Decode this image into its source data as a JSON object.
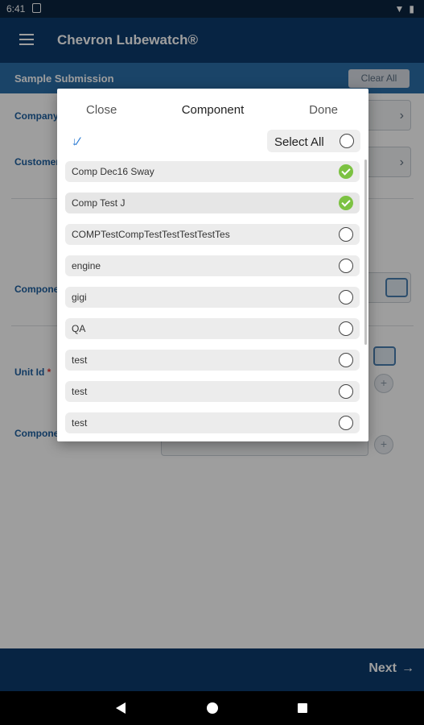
{
  "status_bar": {
    "time": "6:41"
  },
  "app_bar": {
    "title": "Chevron Lubewatch®"
  },
  "sub_header": {
    "title": "Sample Submission",
    "clear_all_label": "Clear All"
  },
  "form": {
    "company_label": "Company",
    "customer_label": "Customer",
    "component_label": "Compone",
    "unit_id_label": "Unit Id",
    "unit_id_required": "*",
    "component2_label": "Compone"
  },
  "bottom_bar": {
    "next_label": "Next",
    "next_arrow": "→"
  },
  "dialog": {
    "close_label": "Close",
    "title": "Component",
    "done_label": "Done",
    "sort_icon_glyph": "↓⁄",
    "select_all_label": "Select All",
    "select_all_checked": false,
    "items": [
      {
        "label": "Comp Dec16 Sway",
        "checked": true
      },
      {
        "label": "Comp Test J",
        "checked": true
      },
      {
        "label": "COMPTestCompTestTestTestTestTes",
        "checked": false
      },
      {
        "label": "engine",
        "checked": false
      },
      {
        "label": "gigi",
        "checked": false
      },
      {
        "label": "QA",
        "checked": false
      },
      {
        "label": "test",
        "checked": false
      },
      {
        "label": "test",
        "checked": false
      },
      {
        "label": "test",
        "checked": false
      }
    ]
  },
  "colors": {
    "app_bar": "#0c3a6d",
    "sub_header": "#2b6ea8",
    "check_green": "#7cc242",
    "label_blue": "#1d5fa0"
  }
}
